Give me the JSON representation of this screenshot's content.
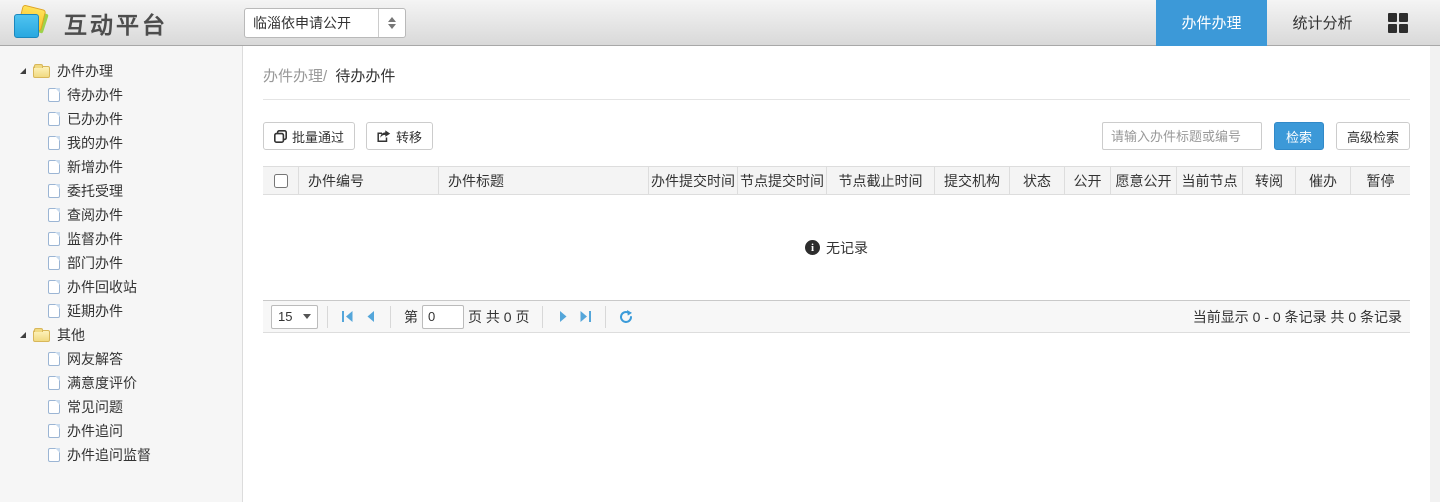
{
  "colors": {
    "accent": "#3c99d8",
    "pager_icon_blue": "#54a6da",
    "header_gradient_top": "#f4f4f4",
    "header_gradient_bottom": "#d9d9d9"
  },
  "header": {
    "title": "互动平台",
    "site_select_value": "临淄依申请公开",
    "tabs": [
      {
        "label": "办件办理",
        "active": true
      },
      {
        "label": "统计分析",
        "active": false
      }
    ]
  },
  "sidebar": {
    "groups": [
      {
        "label": "办件办理",
        "items": [
          "待办办件",
          "已办办件",
          "我的办件",
          "新增办件",
          "委托受理",
          "查阅办件",
          "监督办件",
          "部门办件",
          "办件回收站",
          "延期办件"
        ]
      },
      {
        "label": "其他",
        "items": [
          "网友解答",
          "满意度评价",
          "常见问题",
          "办件追问",
          "办件追问监督"
        ]
      }
    ]
  },
  "main": {
    "breadcrumb": {
      "section": "办件办理/",
      "page": "待办办件"
    },
    "toolbar": {
      "batch_approve": "批量通过",
      "transfer": "转移"
    },
    "search": {
      "placeholder": "请输入办件标题或编号",
      "search_button": "检索",
      "advanced_button": "高级检索"
    },
    "table": {
      "columns": [
        "办件编号",
        "办件标题",
        "办件提交时间",
        "节点提交时间",
        "节点截止时间",
        "提交机构",
        "状态",
        "公开",
        "愿意公开",
        "当前节点",
        "转阅",
        "催办",
        "暂停"
      ],
      "empty_text": "无记录"
    },
    "pagination": {
      "page_size": "15",
      "label_page": "第",
      "page_value": "0",
      "label_total": "页 共 0 页",
      "record_summary": "当前显示 0 - 0 条记录 共 0 条记录"
    }
  }
}
